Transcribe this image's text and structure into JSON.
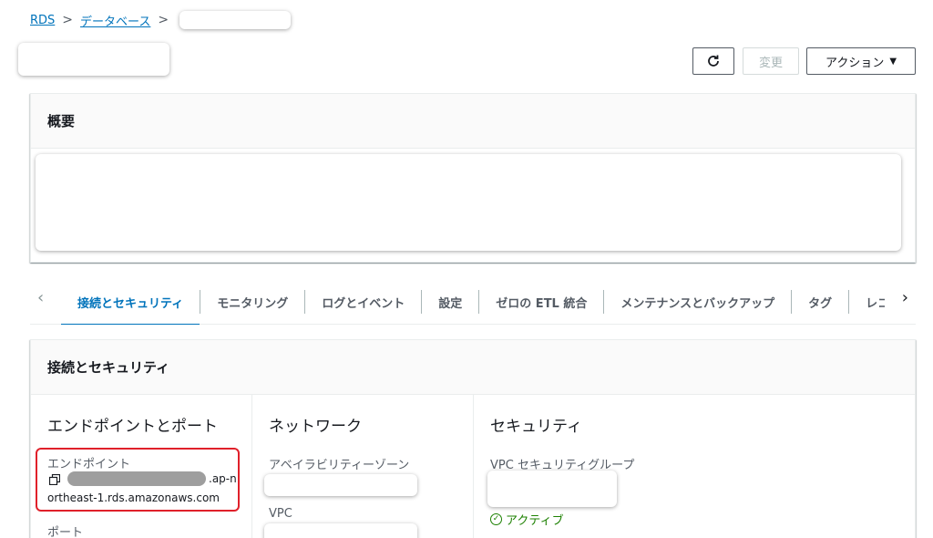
{
  "breadcrumb": {
    "root": "RDS",
    "section": "データベース",
    "separator": ">"
  },
  "header": {
    "refresh_icon": "refresh-icon",
    "modify_label": "変更",
    "actions_label": "アクション",
    "actions_caret": "▼"
  },
  "overview": {
    "title": "概要"
  },
  "tabs": {
    "items": [
      {
        "label": "接続とセキュリティ",
        "active": true
      },
      {
        "label": "モニタリング"
      },
      {
        "label": "ログとイベント"
      },
      {
        "label": "設定"
      },
      {
        "label": "ゼロの ETL 統合"
      },
      {
        "label": "メンテナンスとバックアップ"
      },
      {
        "label": "タグ"
      },
      {
        "label": "レコメ"
      }
    ],
    "left_arrow": "‹",
    "right_arrow": "›"
  },
  "connectivity": {
    "title": "接続とセキュリティ",
    "col1": {
      "title": "エンドポイントとポート",
      "endpoint_label": "エンドポイント",
      "endpoint_suffix": ".ap-n",
      "endpoint_line2": "ortheast-1.rds.amazonaws.com",
      "port_label": "ポート"
    },
    "col2": {
      "title": "ネットワーク",
      "az_label": "アベイラビリティーゾーン",
      "vpc_label": "VPC"
    },
    "col3": {
      "title": "セキュリティ",
      "sg_label": "VPC セキュリティグループ",
      "status": "アクティブ"
    }
  },
  "colors": {
    "link": "#0073bb",
    "highlight_box": "#e0202a",
    "status_active": "#1d8102"
  }
}
